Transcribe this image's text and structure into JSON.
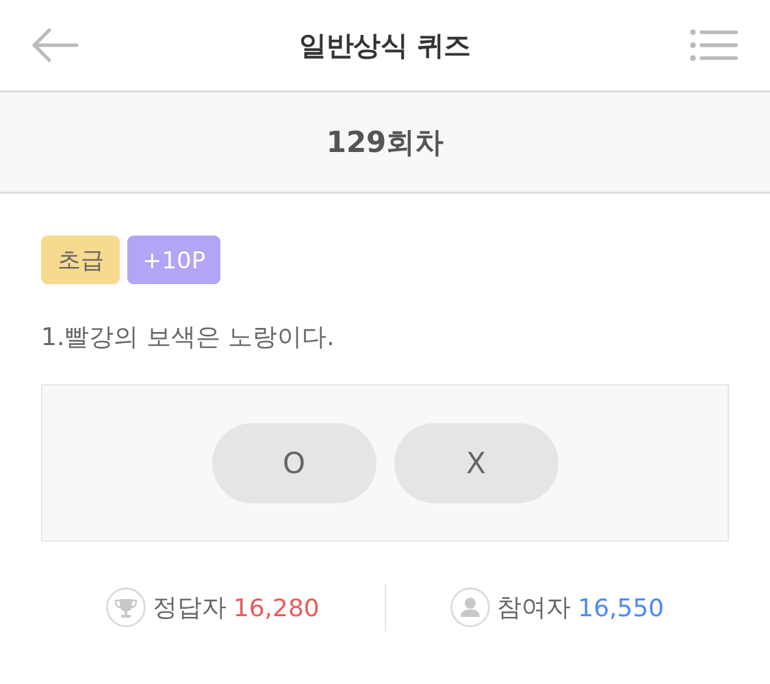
{
  "header": {
    "title": "일반상식 퀴즈"
  },
  "round": {
    "title": "129회차"
  },
  "tags": [
    {
      "kind": "level",
      "label": "초급",
      "color": "#f7da8f"
    },
    {
      "kind": "points",
      "label": "+10P",
      "color": "#b1a5f5"
    }
  ],
  "question": {
    "text": "1.빨강의 보색은 노랑이다."
  },
  "answers": [
    {
      "label": "O",
      "selected": false
    },
    {
      "label": "X",
      "selected": false
    }
  ],
  "stats": [
    {
      "kind": "correct",
      "label": "정답자",
      "value": "16,280",
      "color": "#e85c5c"
    },
    {
      "kind": "participants",
      "label": "참여자",
      "value": "16,550",
      "color": "#4f8af5"
    }
  ]
}
